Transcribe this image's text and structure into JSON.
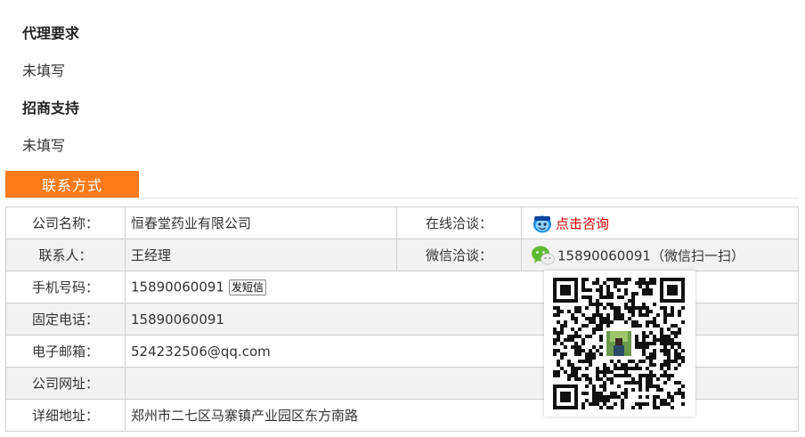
{
  "requirements": {
    "agent_heading": "代理要求",
    "agent_text": "未填写",
    "support_heading": "招商支持",
    "support_text": "未填写"
  },
  "contact_tab": {
    "label": "联系方式"
  },
  "contact": {
    "company_label": "公司名称：",
    "company_value": "恒春堂药业有限公司",
    "online_label": "在线洽谈：",
    "online_link": "点击咨询",
    "person_label": "联系人：",
    "person_value": "王经理",
    "wechat_label": "微信洽谈：",
    "wechat_value": "15890060091（微信扫一扫）",
    "mobile_label": "手机号码：",
    "mobile_value": "15890060091",
    "sms_button": "发短信",
    "phone_label": "固定电话：",
    "phone_value": "15890060091",
    "email_label": "电子邮箱：",
    "email_value": "524232506@qq.com",
    "website_label": "公司网址：",
    "website_value": "",
    "address_label": "详细地址：",
    "address_value": "郑州市二七区马寨镇产业园区东方南路"
  },
  "icons": {
    "online": "qq-chat-icon",
    "wechat": "wechat-icon",
    "qr": "wechat-qr-code"
  },
  "colors": {
    "accent": "#ff7b1a",
    "link": "#d40000",
    "row_alt": "#f2f2f2",
    "border": "#cfcfcf"
  }
}
